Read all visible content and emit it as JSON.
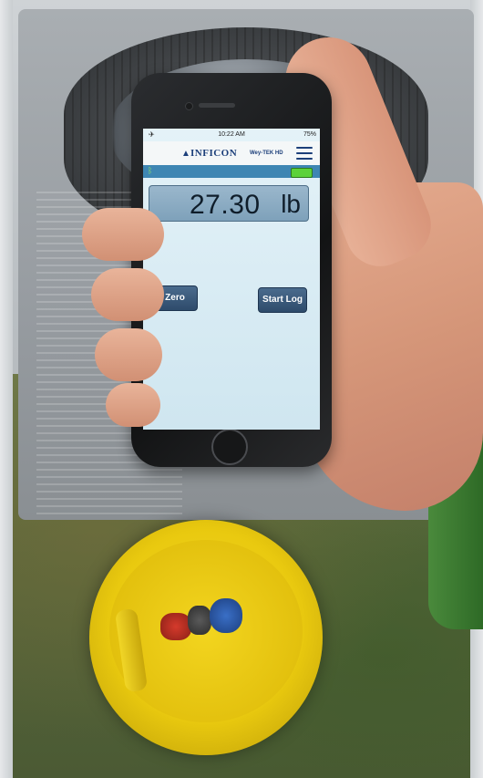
{
  "screen": {
    "status_bar": {
      "signal": "✈",
      "time": "10:22 AM",
      "battery": "75%"
    },
    "header": {
      "brand": "INFICON",
      "product": "Wey-TEK HD"
    },
    "connection": {
      "bluetooth_icon": "bluetooth-icon",
      "battery_icon": "battery-icon"
    },
    "reading": {
      "value": "27.30",
      "unit": "lb"
    },
    "buttons": {
      "zero": "Zero",
      "start_log": "Start Log"
    }
  },
  "colors": {
    "header_bar": "#3e86b3",
    "button": "#2e4b6b",
    "battery": "#5cd23a",
    "cylinder": "#e9c90f"
  }
}
